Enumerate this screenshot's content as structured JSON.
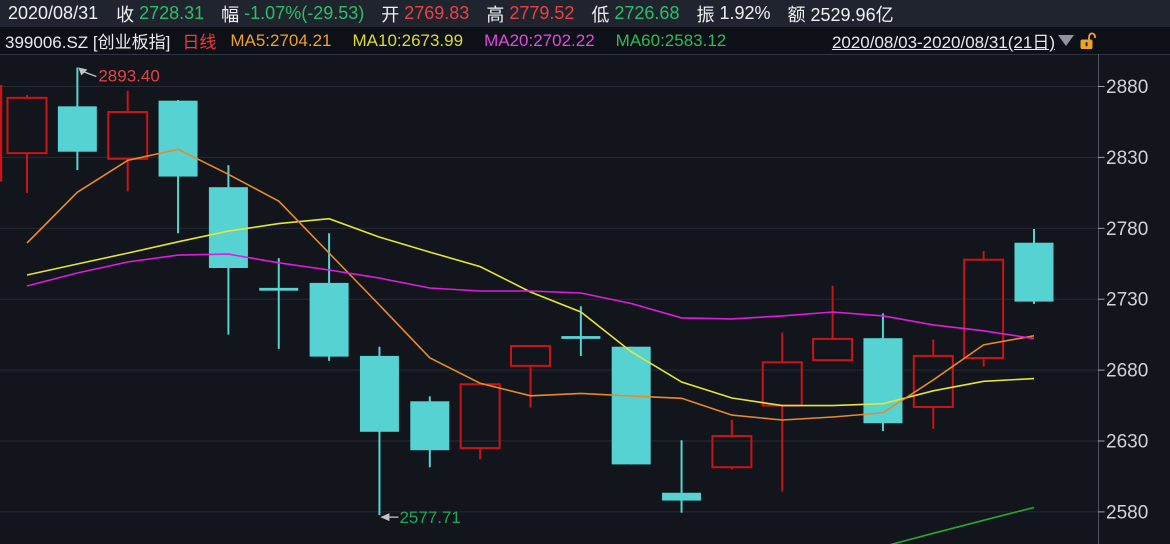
{
  "header": {
    "date": "2020/08/31",
    "fields": [
      {
        "label": "收",
        "value": "2728.31",
        "color": "#2abf66"
      },
      {
        "label": "幅",
        "value": "-1.07%(-29.53)",
        "color": "#2abf66"
      },
      {
        "label": "开",
        "value": "2769.83",
        "color": "#ea4242"
      },
      {
        "label": "高",
        "value": "2779.52",
        "color": "#ea4242"
      },
      {
        "label": "低",
        "value": "2726.68",
        "color": "#2abf66"
      },
      {
        "label": "振",
        "value": "1.92%",
        "color": "#eef0f2"
      },
      {
        "label": "额",
        "value": "2529.96亿",
        "color": "#eef0f2"
      }
    ]
  },
  "toolbar": {
    "symbol": "399006.SZ [创业板指]",
    "period": "日线",
    "period_color": "#f43b3b",
    "ma": [
      {
        "text": "MA5:2704.21",
        "color": "#efa02e"
      },
      {
        "text": "MA10:2673.99",
        "color": "#d9db31"
      },
      {
        "text": "MA20:2702.22",
        "color": "#e14ae1"
      },
      {
        "text": "MA60:2583.12",
        "color": "#33b854"
      }
    ],
    "range": "2020/08/03-2020/08/31(21日)",
    "icons": {
      "dropdown": "triangle-down",
      "lock_state": "unlocked",
      "lock_color": "#eda321"
    }
  },
  "chart_data": {
    "type": "candlestick",
    "title": "399006.SZ 创业板指 日线",
    "ylim": [
      2557,
      2903
    ],
    "yticks": [
      2880,
      2830,
      2780,
      2730,
      2680,
      2630,
      2580
    ],
    "grid": true,
    "candles": [
      {
        "o": 2833.0,
        "h": 2874.0,
        "l": 2805.0,
        "c": 2872.0
      },
      {
        "o": 2866.0,
        "h": 2893.4,
        "l": 2821.0,
        "c": 2834.0
      },
      {
        "o": 2829.0,
        "h": 2877.0,
        "l": 2806.0,
        "c": 2862.0
      },
      {
        "o": 2870.0,
        "h": 2870.5,
        "l": 2776.5,
        "c": 2816.5
      },
      {
        "o": 2809.0,
        "h": 2824.5,
        "l": 2705.0,
        "c": 2752.0
      },
      {
        "o": 2738.0,
        "h": 2759.0,
        "l": 2695.0,
        "c": 2736.0
      },
      {
        "o": 2741.5,
        "h": 2776.5,
        "l": 2686.5,
        "c": 2689.5
      },
      {
        "o": 2690.0,
        "h": 2696.5,
        "l": 2577.71,
        "c": 2636.5
      },
      {
        "o": 2658.0,
        "h": 2661.5,
        "l": 2611.5,
        "c": 2623.5
      },
      {
        "o": 2625.0,
        "h": 2670.0,
        "l": 2617.0,
        "c": 2670.0
      },
      {
        "o": 2683.0,
        "h": 2697.0,
        "l": 2653.5,
        "c": 2697.0
      },
      {
        "o": 2704.0,
        "h": 2725.0,
        "l": 2690.0,
        "c": 2702.0
      },
      {
        "o": 2696.5,
        "h": 2696.5,
        "l": 2613.5,
        "c": 2613.5
      },
      {
        "o": 2593.5,
        "h": 2630.5,
        "l": 2579.5,
        "c": 2588.0
      },
      {
        "o": 2611.5,
        "h": 2645.0,
        "l": 2610.0,
        "c": 2633.5
      },
      {
        "o": 2655.0,
        "h": 2706.5,
        "l": 2594.5,
        "c": 2685.5
      },
      {
        "o": 2687.0,
        "h": 2739.5,
        "l": 2687.0,
        "c": 2702.0
      },
      {
        "o": 2702.5,
        "h": 2720.0,
        "l": 2637.0,
        "c": 2642.5
      },
      {
        "o": 2654.0,
        "h": 2701.5,
        "l": 2638.5,
        "c": 2690.0
      },
      {
        "o": 2688.5,
        "h": 2764.0,
        "l": 2682.5,
        "c": 2757.84
      },
      {
        "o": 2769.83,
        "h": 2779.52,
        "l": 2726.68,
        "c": 2728.31
      }
    ],
    "prev_candle_edge": {
      "top": 2881,
      "bottom": 2813
    },
    "ma_series": [
      {
        "name": "MA5",
        "color": "#e8892b",
        "values": [
          2769.6,
          2805.4,
          2827.9,
          2835.7,
          2818.1,
          2799.1,
          2762.5,
          2725.9,
          2688.7,
          2670.7,
          2661.9,
          2663.6,
          2661.7,
          2660.1,
          2648.3,
          2644.8,
          2646.9,
          2649.8,
          2673.1,
          2697.8,
          2704.21
        ]
      },
      {
        "name": "MA10",
        "color": "#e3e53a",
        "values": [
          2747.1,
          2754.8,
          2762.5,
          2770.5,
          2778.0,
          2783.3,
          2786.8,
          2773.8,
          2763.2,
          2753.0,
          2735.1,
          2721.0,
          2693.0,
          2671.6,
          2660.3,
          2655.0,
          2655.0,
          2656.3,
          2665.4,
          2672.1,
          2673.99
        ]
      },
      {
        "name": "MA20",
        "color": "#dc1edc",
        "values": [
          2739.3,
          2748.5,
          2756.2,
          2761.1,
          2761.8,
          2755.7,
          2750.6,
          2744.9,
          2737.9,
          2735.8,
          2735.8,
          2734.4,
          2727.0,
          2716.8,
          2716.1,
          2718.2,
          2721.0,
          2718.2,
          2711.9,
          2707.7,
          2702.22
        ]
      },
      {
        "name": "MA60",
        "color": "#2aa733",
        "values": [
          null,
          null,
          null,
          null,
          null,
          null,
          null,
          null,
          null,
          null,
          null,
          null,
          null,
          null,
          null,
          null,
          null,
          2555.5,
          2564.9,
          2574.1,
          2583.12
        ]
      }
    ],
    "annotations": [
      {
        "text": "2893.40",
        "price": 2893.4,
        "day": 2,
        "dir": "high",
        "color": "#e64242"
      },
      {
        "text": "2577.71",
        "price": 2577.71,
        "day": 8,
        "dir": "low",
        "color": "#24a757"
      }
    ],
    "colors": {
      "up": "#c91515",
      "down": "#57d2d2",
      "grid": "#262a32",
      "axis": "#4a505c",
      "tick": "#9aa0aa",
      "label": "#ced3da",
      "bg": "#12151c",
      "arrow": "#c0c3c8",
      "divider": "#2f3540"
    }
  }
}
